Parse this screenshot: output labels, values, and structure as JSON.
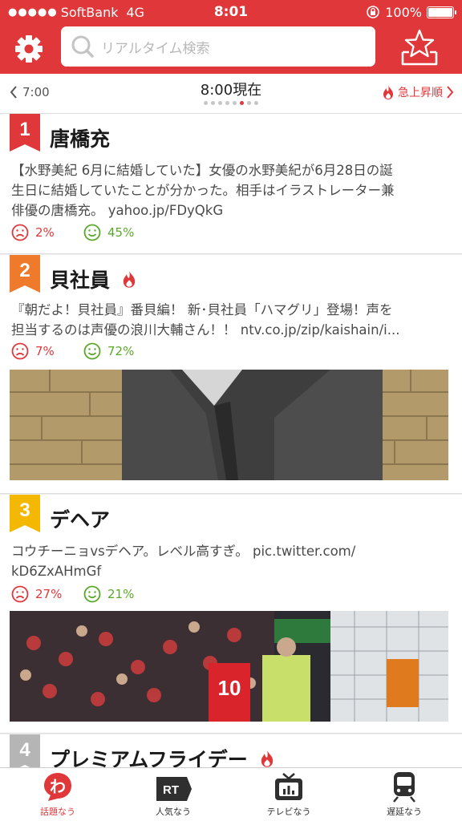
{
  "status_bar": {
    "signal": "●●●●●",
    "carrier": "SoftBank",
    "network": "4G",
    "time": "8:01",
    "battery": "100%"
  },
  "header": {
    "search_placeholder": "リアルタイム検索",
    "settings_icon": "gear-icon",
    "favorites_icon": "star-tray-icon"
  },
  "timebar": {
    "prev": "7:00",
    "title": "8:00現在",
    "next": "急上昇順",
    "page_count": 8,
    "active_page": 6
  },
  "colors": {
    "accent": "#e0383a",
    "rank1": "#e0383a",
    "rank2": "#f07a2c",
    "rank3": "#f5b800",
    "rank4": "#b5b5b5",
    "positive": "#5aa82a"
  },
  "feed": [
    {
      "rank": "1",
      "word": "唐橋充",
      "text_line1": "【水野美紀 6月に結婚していた】女優の水野美紀が6月28日の誕",
      "text_line2": "生日に結婚していたことが分かった。相手はイラストレーター兼",
      "text_line3": "俳優の唐橋充。 yahoo.jp/FDyQkG",
      "negative": "2%",
      "positive": "45%"
    },
    {
      "rank": "2",
      "word": "貝社員",
      "text_line1": "『朝だよ！貝社員』番貝編！ 新･貝社員「ハマグリ」登場！声を",
      "text_line2": "担当するのは声優の浪川大輔さん！！ ntv.co.jp/zip/kaishain/i...",
      "negative": "7%",
      "positive": "72%"
    },
    {
      "rank": "3",
      "word": "デヘア",
      "text_line1": "コウチーニョvsデヘア。レベル高すぎ。 pic.twitter.com/",
      "text_line2": "kD6ZxAHmGf",
      "negative": "27%",
      "positive": "21%"
    },
    {
      "rank": "4",
      "word": "プレミアムフライデー"
    }
  ],
  "tabs": [
    {
      "label": "話題なう",
      "icon": "wa-logo-icon",
      "active": true
    },
    {
      "label": "人気なう",
      "icon": "rt-icon"
    },
    {
      "label": "テレビなう",
      "icon": "tv-icon"
    },
    {
      "label": "遅延なう",
      "icon": "train-icon"
    }
  ]
}
